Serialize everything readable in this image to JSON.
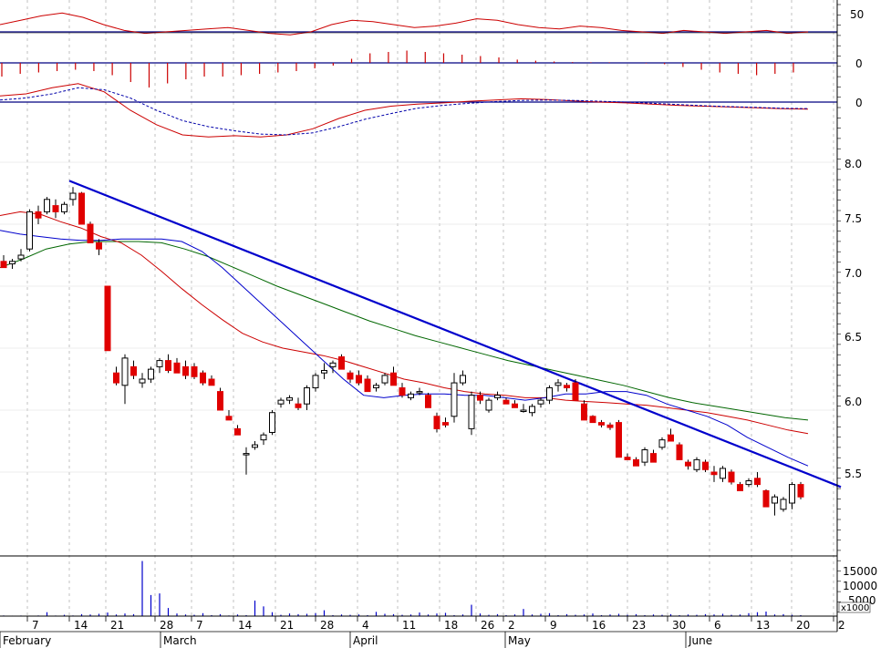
{
  "chart_data": {
    "type": "candlestick",
    "colors": {
      "up_candle": "#ffffff",
      "down_candle": "#e00000",
      "ma_short": "#0000cc",
      "ma_mid": "#cc0000",
      "ma_long": "#006600",
      "trendline": "#0000cc",
      "grid": "#999999",
      "indicator": "#cc0000",
      "ref_line": "#000080"
    },
    "x_axis": {
      "dates": [
        "2/7",
        "2/14",
        "2/21",
        "2/28",
        "3/7",
        "3/14",
        "3/21",
        "3/28",
        "4/4",
        "4/11",
        "4/18",
        "4/26",
        "5/2",
        "5/9",
        "5/16",
        "5/23",
        "5/30",
        "6/6",
        "6/13",
        "6/20"
      ],
      "tick_labels": [
        "7",
        "14",
        "21",
        "28",
        "7",
        "14",
        "21",
        "28",
        "4",
        "11",
        "18",
        "26",
        "2",
        "9",
        "16",
        "23",
        "30",
        "6",
        "13",
        "20",
        "2"
      ],
      "month_labels": [
        "February",
        "March",
        "April",
        "May",
        "June"
      ]
    },
    "price_axis": {
      "ylim": [
        5.0,
        8.2
      ],
      "ticks": [
        "8.0",
        "7.5",
        "7.0",
        "6.5",
        "6.0",
        "5.5"
      ]
    },
    "volume_axis": {
      "ylim": [
        0,
        18000
      ],
      "ticks": [
        "15000",
        "10000",
        "5000"
      ],
      "unit_label": "x1000"
    },
    "indicator_axes": {
      "rsi_ticks": [
        "50"
      ],
      "hist_ticks": [
        "0"
      ],
      "macd_ticks": [
        "0"
      ]
    },
    "candles": [
      [
        7.2,
        7.25,
        7.15,
        7.15
      ],
      [
        7.18,
        7.22,
        7.14,
        7.2
      ],
      [
        7.22,
        7.3,
        7.2,
        7.25
      ],
      [
        7.3,
        7.62,
        7.28,
        7.6
      ],
      [
        7.6,
        7.65,
        7.5,
        7.55
      ],
      [
        7.6,
        7.72,
        7.58,
        7.7
      ],
      [
        7.65,
        7.7,
        7.55,
        7.6
      ],
      [
        7.6,
        7.68,
        7.58,
        7.66
      ],
      [
        7.7,
        7.8,
        7.65,
        7.75
      ],
      [
        7.75,
        7.76,
        7.5,
        7.5
      ],
      [
        7.5,
        7.52,
        7.35,
        7.35
      ],
      [
        7.35,
        7.38,
        7.25,
        7.3
      ],
      [
        7.0,
        7.0,
        6.48,
        6.48
      ],
      [
        6.3,
        6.35,
        6.2,
        6.22
      ],
      [
        6.2,
        6.45,
        6.05,
        6.42
      ],
      [
        6.35,
        6.4,
        6.25,
        6.28
      ],
      [
        6.22,
        6.3,
        6.18,
        6.25
      ],
      [
        6.25,
        6.35,
        6.22,
        6.33
      ],
      [
        6.35,
        6.42,
        6.3,
        6.4
      ],
      [
        6.4,
        6.45,
        6.3,
        6.32
      ],
      [
        6.38,
        6.42,
        6.3,
        6.3
      ],
      [
        6.35,
        6.4,
        6.25,
        6.28
      ],
      [
        6.35,
        6.38,
        6.25,
        6.27
      ],
      [
        6.3,
        6.32,
        6.2,
        6.22
      ],
      [
        6.25,
        6.28,
        6.2,
        6.2
      ],
      [
        6.15,
        6.18,
        6.0,
        6.0
      ],
      [
        5.95,
        6.0,
        5.92,
        5.92
      ],
      [
        5.85,
        5.88,
        5.8,
        5.8
      ],
      [
        5.65,
        5.7,
        5.48,
        5.65
      ],
      [
        5.7,
        5.75,
        5.68,
        5.72
      ],
      [
        5.76,
        5.82,
        5.72,
        5.8
      ],
      [
        5.82,
        6.0,
        5.8,
        5.98
      ],
      [
        6.05,
        6.1,
        6.02,
        6.08
      ],
      [
        6.08,
        6.12,
        6.05,
        6.1
      ],
      [
        6.05,
        6.1,
        6.0,
        6.02
      ],
      [
        6.05,
        6.2,
        6.0,
        6.18
      ],
      [
        6.18,
        6.3,
        6.15,
        6.28
      ],
      [
        6.3,
        6.38,
        6.25,
        6.32
      ],
      [
        6.35,
        6.4,
        6.3,
        6.38
      ],
      [
        6.43,
        6.45,
        6.33,
        6.33
      ],
      [
        6.3,
        6.32,
        6.22,
        6.25
      ],
      [
        6.28,
        6.32,
        6.2,
        6.22
      ],
      [
        6.25,
        6.28,
        6.15,
        6.15
      ],
      [
        6.18,
        6.22,
        6.15,
        6.2
      ],
      [
        6.22,
        6.3,
        6.2,
        6.28
      ],
      [
        6.3,
        6.35,
        6.2,
        6.2
      ],
      [
        6.18,
        6.22,
        6.1,
        6.12
      ],
      [
        6.1,
        6.15,
        6.08,
        6.13
      ],
      [
        6.15,
        6.18,
        6.12,
        6.15
      ],
      [
        6.12,
        6.14,
        6.02,
        6.02
      ],
      [
        5.95,
        5.98,
        5.82,
        5.85
      ],
      [
        5.9,
        5.94,
        5.86,
        5.88
      ],
      [
        5.95,
        6.3,
        5.9,
        6.22
      ],
      [
        6.22,
        6.32,
        6.2,
        6.28
      ],
      [
        5.85,
        6.15,
        5.8,
        6.12
      ],
      [
        6.12,
        6.15,
        6.05,
        6.08
      ],
      [
        6.0,
        6.1,
        5.98,
        6.08
      ],
      [
        6.1,
        6.15,
        6.08,
        6.12
      ],
      [
        6.08,
        6.1,
        6.05,
        6.05
      ],
      [
        6.05,
        6.08,
        6.02,
        6.02
      ],
      [
        6.0,
        6.05,
        5.98,
        6.0
      ],
      [
        5.98,
        6.05,
        5.95,
        6.03
      ],
      [
        6.05,
        6.1,
        6.02,
        6.08
      ],
      [
        6.08,
        6.2,
        6.05,
        6.18
      ],
      [
        6.2,
        6.25,
        6.15,
        6.22
      ],
      [
        6.2,
        6.22,
        6.15,
        6.18
      ],
      [
        6.22,
        6.25,
        6.08,
        6.08
      ],
      [
        6.05,
        6.08,
        5.92,
        5.92
      ],
      [
        5.95,
        5.96,
        5.9,
        5.9
      ],
      [
        5.9,
        5.92,
        5.86,
        5.88
      ],
      [
        5.88,
        5.9,
        5.84,
        5.86
      ],
      [
        5.9,
        5.92,
        5.62,
        5.62
      ],
      [
        5.62,
        5.65,
        5.6,
        5.6
      ],
      [
        5.6,
        5.62,
        5.55,
        5.55
      ],
      [
        5.58,
        5.7,
        5.55,
        5.68
      ],
      [
        5.65,
        5.68,
        5.58,
        5.58
      ],
      [
        5.7,
        5.78,
        5.68,
        5.76
      ],
      [
        5.8,
        5.85,
        5.75,
        5.75
      ],
      [
        5.72,
        5.74,
        5.6,
        5.6
      ],
      [
        5.58,
        5.6,
        5.52,
        5.55
      ],
      [
        5.52,
        5.62,
        5.5,
        5.6
      ],
      [
        5.58,
        5.6,
        5.5,
        5.52
      ],
      [
        5.5,
        5.55,
        5.42,
        5.48
      ],
      [
        5.45,
        5.55,
        5.42,
        5.53
      ],
      [
        5.5,
        5.52,
        5.4,
        5.42
      ],
      [
        5.4,
        5.42,
        5.35,
        5.35
      ],
      [
        5.4,
        5.45,
        5.38,
        5.43
      ],
      [
        5.45,
        5.5,
        5.38,
        5.4
      ],
      [
        5.35,
        5.36,
        5.22,
        5.22
      ],
      [
        5.25,
        5.32,
        5.15,
        5.3
      ],
      [
        5.2,
        5.3,
        5.18,
        5.28
      ],
      [
        5.25,
        5.42,
        5.2,
        5.4
      ],
      [
        5.4,
        5.42,
        5.28,
        5.3
      ]
    ],
    "volume": [
      200,
      150,
      180,
      150,
      200,
      1200,
      180,
      400,
      200,
      600,
      500,
      700,
      1100,
      500,
      800,
      600,
      17000,
      6500,
      7000,
      2500,
      800,
      500,
      400,
      900,
      300,
      600,
      200,
      500,
      300,
      4800,
      3000,
      1200,
      400,
      800,
      600,
      700,
      900,
      1800,
      300,
      500,
      400,
      500,
      300,
      1300,
      700,
      600,
      400,
      500,
      1100,
      500,
      800,
      1000,
      300,
      500,
      3500,
      800,
      400,
      600,
      300,
      500,
      2200,
      500,
      700,
      900,
      300,
      600,
      400,
      500,
      800,
      300,
      500,
      700,
      400,
      600,
      300,
      500,
      400,
      600,
      300,
      500,
      400,
      600,
      500,
      700,
      400,
      500,
      900,
      1200,
      1400,
      500,
      600,
      400,
      300
    ],
    "ma_short": [
      7.45,
      7.42,
      7.4,
      7.38,
      7.37,
      7.37,
      7.38,
      7.38,
      7.38,
      7.36,
      7.28,
      7.15,
      7.0,
      6.85,
      6.7,
      6.55,
      6.4,
      6.25,
      6.12,
      6.1,
      6.12,
      6.13,
      6.13,
      6.12,
      6.12,
      6.1,
      6.08,
      6.1,
      6.13,
      6.13,
      6.15,
      6.15,
      6.12,
      6.05,
      6.0,
      5.95,
      5.88,
      5.78,
      5.7,
      5.62,
      5.55
    ],
    "ma_mid": [
      7.57,
      7.6,
      7.58,
      7.52,
      7.47,
      7.4,
      7.35,
      7.25,
      7.12,
      6.98,
      6.85,
      6.73,
      6.62,
      6.55,
      6.5,
      6.47,
      6.44,
      6.4,
      6.35,
      6.3,
      6.25,
      6.22,
      6.18,
      6.15,
      6.13,
      6.12,
      6.1,
      6.1,
      6.08,
      6.07,
      6.06,
      6.05,
      6.04,
      6.02,
      6.0,
      5.98,
      5.95,
      5.92,
      5.88,
      5.84,
      5.81
    ],
    "ma_long": [
      7.15,
      7.22,
      7.3,
      7.34,
      7.36,
      7.36,
      7.36,
      7.35,
      7.3,
      7.24,
      7.16,
      7.08,
      7.0,
      6.93,
      6.86,
      6.79,
      6.72,
      6.66,
      6.6,
      6.55,
      6.5,
      6.45,
      6.4,
      6.36,
      6.32,
      6.28,
      6.24,
      6.2,
      6.15,
      6.1,
      6.06,
      6.03,
      6.0,
      5.97,
      5.94,
      5.92
    ],
    "trendline": {
      "from": [
        8,
        7.85
      ],
      "to": [
        96,
        5.38
      ]
    },
    "rsi": [
      52,
      55,
      58,
      60,
      57,
      52,
      48,
      46,
      47,
      48,
      49,
      50,
      48,
      46,
      45,
      47,
      52,
      55,
      54,
      52,
      50,
      51,
      53,
      56,
      55,
      52,
      50,
      49,
      51,
      50,
      48,
      47,
      46,
      48,
      47,
      46,
      47,
      48,
      46,
      47
    ],
    "macd_hist": [
      -0.5,
      -0.4,
      -0.35,
      -0.3,
      -0.25,
      -0.3,
      -0.45,
      -0.7,
      -0.9,
      -0.75,
      -0.6,
      -0.5,
      -0.5,
      -0.45,
      -0.4,
      -0.35,
      -0.3,
      -0.2,
      -0.1,
      0.15,
      0.35,
      0.4,
      0.45,
      0.4,
      0.35,
      0.3,
      0.25,
      0.2,
      0.12,
      0.08,
      0.05,
      0.03,
      0.02,
      0.02,
      0.0,
      -0.02,
      -0.05,
      -0.15,
      -0.25,
      -0.35,
      -0.4,
      -0.45,
      -0.4,
      -0.35
    ],
    "macd_line": [
      0.15,
      0.2,
      0.35,
      0.45,
      0.25,
      -0.2,
      -0.55,
      -0.8,
      -0.85,
      -0.82,
      -0.85,
      -0.8,
      -0.65,
      -0.4,
      -0.2,
      -0.1,
      -0.05,
      -0.02,
      0.02,
      0.05,
      0.08,
      0.06,
      0.03,
      0.0,
      -0.02,
      -0.05,
      -0.08,
      -0.1,
      -0.12,
      -0.14,
      -0.16,
      -0.17
    ],
    "macd_signal": [
      0.05,
      0.1,
      0.2,
      0.35,
      0.3,
      0.1,
      -0.2,
      -0.45,
      -0.6,
      -0.7,
      -0.78,
      -0.8,
      -0.75,
      -0.6,
      -0.42,
      -0.28,
      -0.15,
      -0.08,
      -0.03,
      0.01,
      0.04,
      0.05,
      0.04,
      0.02,
      0.0,
      -0.03,
      -0.06,
      -0.09,
      -0.11,
      -0.13,
      -0.15,
      -0.16
    ]
  }
}
